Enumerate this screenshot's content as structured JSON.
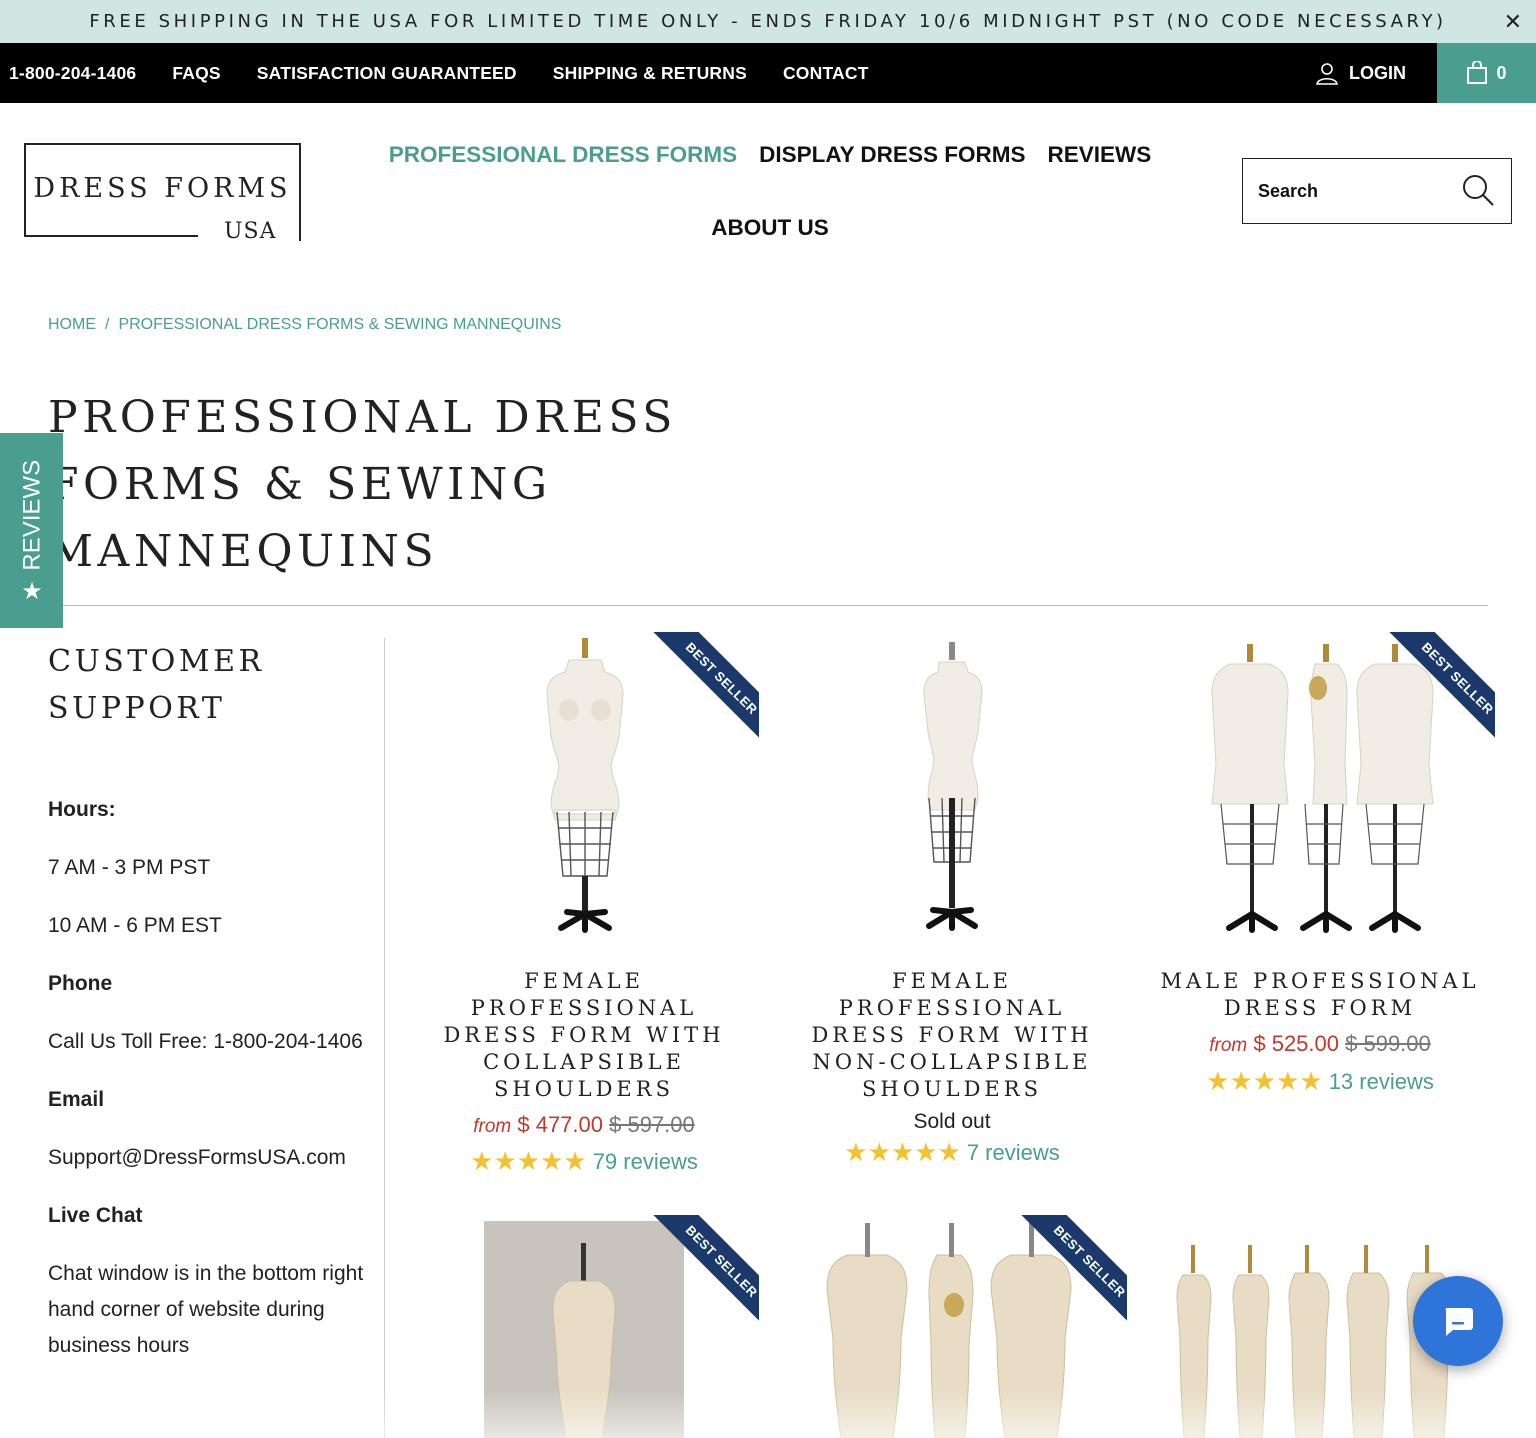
{
  "announcement": {
    "text": "FREE SHIPPING IN THE USA FOR LIMITED TIME ONLY - ENDS FRIDAY 10/6 MIDNIGHT PST (NO CODE NECESSARY)",
    "close": "✕"
  },
  "topbar": {
    "phone": "1-800-204-1406",
    "links": [
      "FAQS",
      "SATISFACTION GUARANTEED",
      "SHIPPING & RETURNS",
      "CONTACT"
    ],
    "login": "LOGIN",
    "cart_count": "0"
  },
  "logo": {
    "main": "DRESS FORMS",
    "sub": "USA"
  },
  "nav": {
    "items": [
      "PROFESSIONAL DRESS FORMS",
      "DISPLAY DRESS FORMS",
      "REVIEWS",
      "ABOUT US"
    ]
  },
  "search": {
    "placeholder": "Search"
  },
  "breadcrumb": {
    "home": "HOME",
    "separator": "/",
    "current": "PROFESSIONAL DRESS FORMS & SEWING MANNEQUINS"
  },
  "page_title": "PROFESSIONAL DRESS FORMS & SEWING MANNEQUINS",
  "reviews_tab": {
    "label": "REVIEWS",
    "star": "★"
  },
  "sidebar": {
    "title": "CUSTOMER SUPPORT",
    "hours_label": "Hours:",
    "hours_pst": "7 AM - 3 PM PST",
    "hours_est": "10 AM - 6 PM EST",
    "phone_label": "Phone",
    "phone_text": "Call Us Toll Free: 1-800-204-1406",
    "email_label": "Email",
    "email_text": "Support@DressFormsUSA.com",
    "chat_label": "Live Chat",
    "chat_text": "Chat window is in the bottom right hand corner of website during business hours"
  },
  "products": [
    {
      "title": "FEMALE PROFESSIONAL DRESS FORM WITH COLLAPSIBLE SHOULDERS",
      "from": "from",
      "price": "$ 477.00",
      "was": "$ 597.00",
      "stars": "★★★★★",
      "reviews": "79 reviews",
      "badge": "BEST SELLER"
    },
    {
      "title": "FEMALE PROFESSIONAL DRESS FORM WITH NON-COLLAPSIBLE SHOULDERS",
      "sold": "Sold out",
      "stars": "★★★★★",
      "reviews": "7 reviews"
    },
    {
      "title": "MALE PROFESSIONAL DRESS FORM",
      "from": "from",
      "price": "$ 525.00",
      "was": "$ 599.00",
      "stars": "★★★★★",
      "reviews": "13 reviews",
      "badge": "BEST SELLER"
    },
    {
      "badge": "BEST SELLER"
    },
    {
      "badge": "BEST SELLER"
    },
    {}
  ],
  "colors": {
    "teal": "#4a9e8f",
    "sale": "#c0392b",
    "ribbon": "#1b3a6b",
    "chat": "#2f74d8",
    "star": "#f2c230"
  }
}
